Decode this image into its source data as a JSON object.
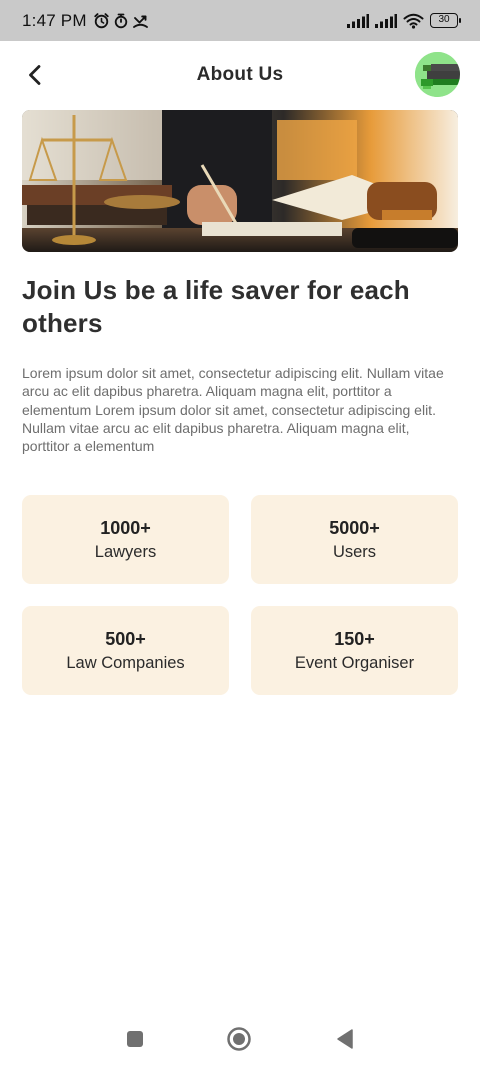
{
  "status_bar": {
    "time": "1:47 PM",
    "battery": "30",
    "icons": [
      "alarm-icon",
      "timer-icon",
      "missed-call-icon",
      "signal-icon",
      "signal-icon",
      "wifi-icon",
      "battery-icon"
    ]
  },
  "header": {
    "title": "About Us",
    "back_icon": "chevron-left-icon",
    "avatar_icon": "profile-avatar"
  },
  "hero": {
    "icon": "law-office-photo"
  },
  "content": {
    "headline": "Join Us be a life saver for each others",
    "body": "Lorem ipsum dolor sit amet, consectetur adipiscing elit. Nullam vitae arcu ac elit dapibus pharetra. Aliquam magna elit, porttitor a elementum Lorem ipsum dolor sit amet, consectetur adipiscing elit. Nullam vitae arcu ac elit dapibus pharetra. Aliquam magna elit, porttitor a elementum"
  },
  "stats": [
    {
      "value": "1000+",
      "label": "Lawyers"
    },
    {
      "value": "5000+",
      "label": "Users"
    },
    {
      "value": "500+",
      "label": "Law Companies"
    },
    {
      "value": "150+",
      "label": "Event Organiser"
    }
  ],
  "nav": {
    "icons": [
      "recent-apps-icon",
      "home-icon",
      "back-triangle-icon"
    ]
  },
  "colors": {
    "status_bar": "#c9c9c9",
    "card_bg": "#fbf1e1",
    "text_dark": "#2b2b2b",
    "text_muted": "#6e6e6e",
    "avatar_bg": "#8fe38a"
  }
}
